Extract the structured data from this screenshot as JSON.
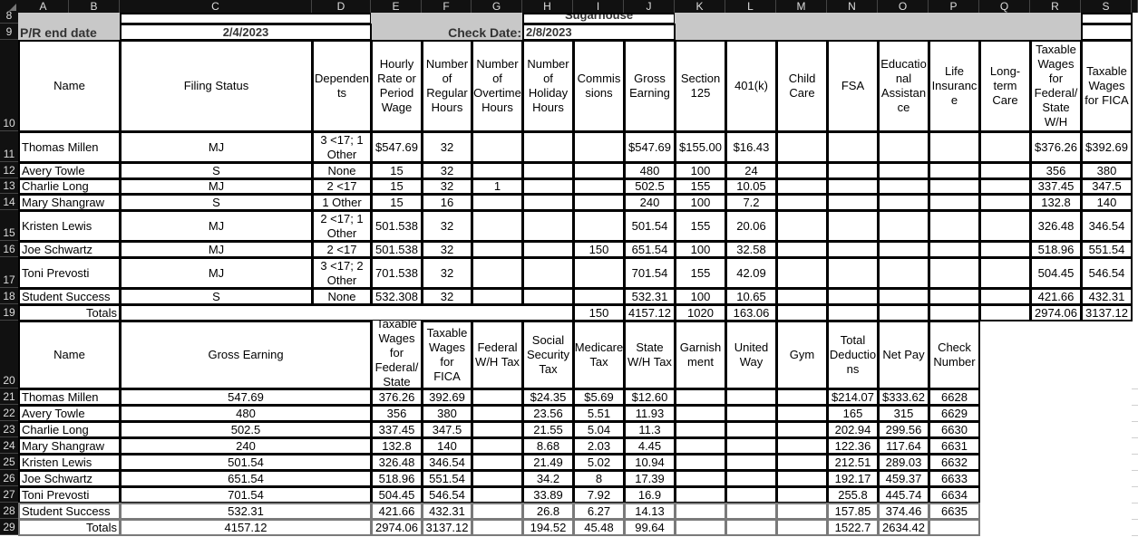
{
  "columns": [
    "A",
    "B",
    "C",
    "D",
    "E",
    "F",
    "G",
    "H",
    "I",
    "J",
    "K",
    "L",
    "M",
    "N",
    "O",
    "P",
    "Q",
    "R",
    "S"
  ],
  "rows": [
    "8",
    "9",
    "10",
    "11",
    "12",
    "13",
    "14",
    "15",
    "16",
    "17",
    "18",
    "19",
    "20",
    "21",
    "22",
    "23",
    "24",
    "25",
    "26",
    "27",
    "28",
    "29"
  ],
  "header": {
    "company_partial": "Sugarhouse",
    "pr_end_label": "P/R end date",
    "pr_end_value": "2/4/2023",
    "check_date_label": "Check Date:",
    "check_date_value": "2/8/2023"
  },
  "table1": {
    "headers": {
      "name": "Name",
      "filing_status": "Filing Status",
      "dependents": "Dependen\nts",
      "rate": "Hourly\nRate or\nPeriod\nWage",
      "regular": "Number\nof\nRegular\nHours",
      "overtime": "Number\nof\nOvertime\nHours",
      "holiday": "Number\nof\nHoliday\nHours",
      "commissions": "Commis\nsions",
      "gross": "Gross\nEarning",
      "sec125": "Section\n125",
      "k401": "401(k)",
      "childcare": "Child\nCare",
      "fsa": "FSA",
      "edu": "Educatio\nnal\nAssistan\nce",
      "life": "Life\nInsuranc\ne",
      "ltc": "Long-\nterm\nCare",
      "taxable_fed": "Taxable\nWages\nfor\nFederal/\nState\nW/H",
      "taxable_fica": "Taxable\nWages\nfor FICA"
    },
    "rows": [
      {
        "name": "Thomas Millen",
        "filing": "MJ",
        "dependents": "3 <17; 1\nOther",
        "rate": "$547.69",
        "regular": "32",
        "overtime": "",
        "holiday": "",
        "commissions": "",
        "gross": "$547.69",
        "sec125": "$155.00",
        "k401": "$16.43",
        "taxable_fed": "$376.26",
        "taxable_fica": "$392.69"
      },
      {
        "name": "Avery Towle",
        "filing": "S",
        "dependents": "None",
        "rate": "15",
        "regular": "32",
        "overtime": "",
        "holiday": "",
        "commissions": "",
        "gross": "480",
        "sec125": "100",
        "k401": "24",
        "taxable_fed": "356",
        "taxable_fica": "380"
      },
      {
        "name": "Charlie Long",
        "filing": "MJ",
        "dependents": "2 <17",
        "rate": "15",
        "regular": "32",
        "overtime": "1",
        "holiday": "",
        "commissions": "",
        "gross": "502.5",
        "sec125": "155",
        "k401": "10.05",
        "taxable_fed": "337.45",
        "taxable_fica": "347.5"
      },
      {
        "name": "Mary Shangraw",
        "filing": "S",
        "dependents": "1 Other",
        "rate": "15",
        "regular": "16",
        "overtime": "",
        "holiday": "",
        "commissions": "",
        "gross": "240",
        "sec125": "100",
        "k401": "7.2",
        "taxable_fed": "132.8",
        "taxable_fica": "140"
      },
      {
        "name": "Kristen Lewis",
        "filing": "MJ",
        "dependents": "2 <17; 1\nOther",
        "rate": "501.538",
        "regular": "32",
        "overtime": "",
        "holiday": "",
        "commissions": "",
        "gross": "501.54",
        "sec125": "155",
        "k401": "20.06",
        "taxable_fed": "326.48",
        "taxable_fica": "346.54"
      },
      {
        "name": "Joe Schwartz",
        "filing": "MJ",
        "dependents": "2 <17",
        "rate": "501.538",
        "regular": "32",
        "overtime": "",
        "holiday": "",
        "commissions": "150",
        "gross": "651.54",
        "sec125": "100",
        "k401": "32.58",
        "taxable_fed": "518.96",
        "taxable_fica": "551.54"
      },
      {
        "name": "Toni Prevosti",
        "filing": "MJ",
        "dependents": "3 <17; 2\nOther",
        "rate": "701.538",
        "regular": "32",
        "overtime": "",
        "holiday": "",
        "commissions": "",
        "gross": "701.54",
        "sec125": "155",
        "k401": "42.09",
        "taxable_fed": "504.45",
        "taxable_fica": "546.54"
      },
      {
        "name": "Student Success",
        "filing": "S",
        "dependents": "None",
        "rate": "532.308",
        "regular": "32",
        "overtime": "",
        "holiday": "",
        "commissions": "",
        "gross": "532.31",
        "sec125": "100",
        "k401": "10.65",
        "taxable_fed": "421.66",
        "taxable_fica": "432.31"
      }
    ],
    "totals": {
      "label": "Totals",
      "commissions": "150",
      "gross": "4157.12",
      "sec125": "1020",
      "k401": "163.06",
      "taxable_fed": "2974.06",
      "taxable_fica": "3137.12"
    }
  },
  "table2": {
    "headers": {
      "name": "Name",
      "gross": "Gross Earning",
      "taxable_fed": "Taxable\nWages\nfor\nFederal/\nState\nW/H",
      "taxable_fica": "Taxable\nWages\nfor FICA",
      "fed_wh": "Federal\nW/H Tax",
      "ss": "Social\nSecurity\nTax",
      "medicare": "Medicare\nTax",
      "state_wh": "State\nW/H Tax",
      "garnish": "Garnish\nment",
      "united_way": "United\nWay",
      "gym": "Gym",
      "total_ded": "Total\nDeductio\nns",
      "net_pay": "Net Pay",
      "check": "Check\nNumber"
    },
    "rows": [
      {
        "name": "Thomas Millen",
        "gross": "547.69",
        "taxable_fed": "376.26",
        "taxable_fica": "392.69",
        "fed_wh": "",
        "ss": "$24.35",
        "medicare": "$5.69",
        "state_wh": "$12.60",
        "total_ded": "$214.07",
        "net_pay": "$333.62",
        "check": "6628"
      },
      {
        "name": "Avery Towle",
        "gross": "480",
        "taxable_fed": "356",
        "taxable_fica": "380",
        "fed_wh": "",
        "ss": "23.56",
        "medicare": "5.51",
        "state_wh": "11.93",
        "total_ded": "165",
        "net_pay": "315",
        "check": "6629"
      },
      {
        "name": "Charlie Long",
        "gross": "502.5",
        "taxable_fed": "337.45",
        "taxable_fica": "347.5",
        "fed_wh": "",
        "ss": "21.55",
        "medicare": "5.04",
        "state_wh": "11.3",
        "total_ded": "202.94",
        "net_pay": "299.56",
        "check": "6630"
      },
      {
        "name": "Mary Shangraw",
        "gross": "240",
        "taxable_fed": "132.8",
        "taxable_fica": "140",
        "fed_wh": "",
        "ss": "8.68",
        "medicare": "2.03",
        "state_wh": "4.45",
        "total_ded": "122.36",
        "net_pay": "117.64",
        "check": "6631"
      },
      {
        "name": "Kristen Lewis",
        "gross": "501.54",
        "taxable_fed": "326.48",
        "taxable_fica": "346.54",
        "fed_wh": "",
        "ss": "21.49",
        "medicare": "5.02",
        "state_wh": "10.94",
        "total_ded": "212.51",
        "net_pay": "289.03",
        "check": "6632"
      },
      {
        "name": "Joe Schwartz",
        "gross": "651.54",
        "taxable_fed": "518.96",
        "taxable_fica": "551.54",
        "fed_wh": "",
        "ss": "34.2",
        "medicare": "8",
        "state_wh": "17.39",
        "total_ded": "192.17",
        "net_pay": "459.37",
        "check": "6633"
      },
      {
        "name": "Toni Prevosti",
        "gross": "701.54",
        "taxable_fed": "504.45",
        "taxable_fica": "546.54",
        "fed_wh": "",
        "ss": "33.89",
        "medicare": "7.92",
        "state_wh": "16.9",
        "total_ded": "255.8",
        "net_pay": "445.74",
        "check": "6634"
      },
      {
        "name": "Student Success",
        "gross": "532.31",
        "taxable_fed": "421.66",
        "taxable_fica": "432.31",
        "fed_wh": "",
        "ss": "26.8",
        "medicare": "6.27",
        "state_wh": "14.13",
        "total_ded": "157.85",
        "net_pay": "374.46",
        "check": "6635"
      }
    ],
    "totals": {
      "label": "Totals",
      "gross": "4157.12",
      "taxable_fed": "2974.06",
      "taxable_fica": "3137.12",
      "ss": "194.52",
      "medicare": "45.48",
      "state_wh": "99.64",
      "total_ded": "1522.7",
      "net_pay": "2634.42"
    }
  }
}
